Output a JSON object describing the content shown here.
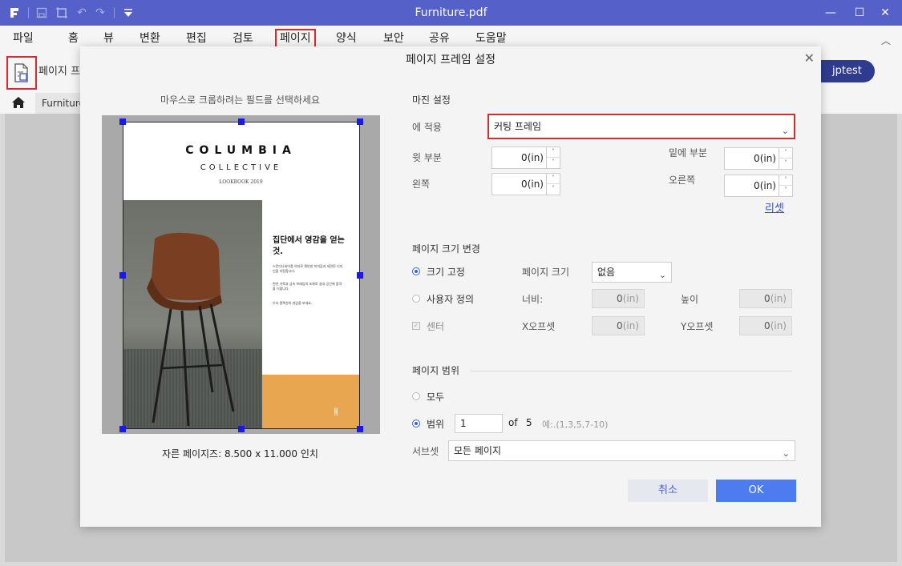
{
  "window": {
    "title": "Furniture.pdf",
    "controls": {
      "minimize": "—",
      "maximize": "☐",
      "close": "✕"
    }
  },
  "menu": {
    "items": [
      "파일",
      "홈",
      "뷰",
      "변환",
      "편집",
      "검토",
      "페이지",
      "양식",
      "보안",
      "공유",
      "도움말"
    ],
    "active": "페이지"
  },
  "toolbar": {
    "tool_label": "페이지 프",
    "user_label": "jptest"
  },
  "breadcrumb": {
    "tab": "Furniture"
  },
  "dialog": {
    "title": "페이지 프레임 설정",
    "hint": "마우스로 크롭하려는 필드를 선택하세요",
    "preview": {
      "brand": "COLUMBIA",
      "subtitle": "COLLECTIVE",
      "lookbook": "LOOKBOOK 2019",
      "heading": "집단에서 영감을 얻는것.",
      "paragraphs": [
        "스칸디나비아풍 의자로 편안한 착석감과 세련된 디자인을 자랑합니다.",
        "천연 가죽과 금속 프레임의 조화로 실내 공간에 품격을 더합니다.",
        "우리 컬렉션의 영감을 보세요."
      ]
    },
    "page_size_text": "자른 페이지즈: 8.500 x 11.000 인치",
    "margin": {
      "section": "마진 설정",
      "apply_label": "에 적용",
      "apply_value": "커팅 프레임",
      "top_label": "윗 부분",
      "top_value": "0",
      "bottom_label": "밑에 부분",
      "bottom_value": "0",
      "left_label": "왼쪽",
      "left_value": "0",
      "right_label": "오른쪽",
      "right_value": "0",
      "unit": "(in)",
      "reset": "리셋"
    },
    "resize": {
      "section": "페이지 크기 변경",
      "fixed_label": "크기 고정",
      "custom_label": "사용자 정의",
      "center_label": "센터",
      "page_size_label": "페이지 크기",
      "page_size_value": "없음",
      "width_label": "너비:",
      "width_value": "0",
      "height_label": "높이",
      "height_value": "0",
      "xoffset_label": "X오프셋",
      "xoffset_value": "0",
      "yoffset_label": "Y오프셋",
      "yoffset_value": "0",
      "unit": "(in)"
    },
    "range": {
      "section": "페이지 범위",
      "all_label": "모두",
      "range_label": "범위",
      "range_value": "1",
      "of_label": "of",
      "total_pages": "5",
      "example": "예:.(1,3,5,7-10)",
      "subset_label": "서브셋",
      "subset_value": "모든 페이지"
    },
    "cancel": "취소",
    "ok": "OK"
  },
  "colors": {
    "titlebar": "#5561c9",
    "highlight": "#d82a2a",
    "ok_button": "#4d7cf0",
    "user_button": "#2f3b8f",
    "crop_handle": "#1a1ae6",
    "orange_block": "#e8a651"
  }
}
